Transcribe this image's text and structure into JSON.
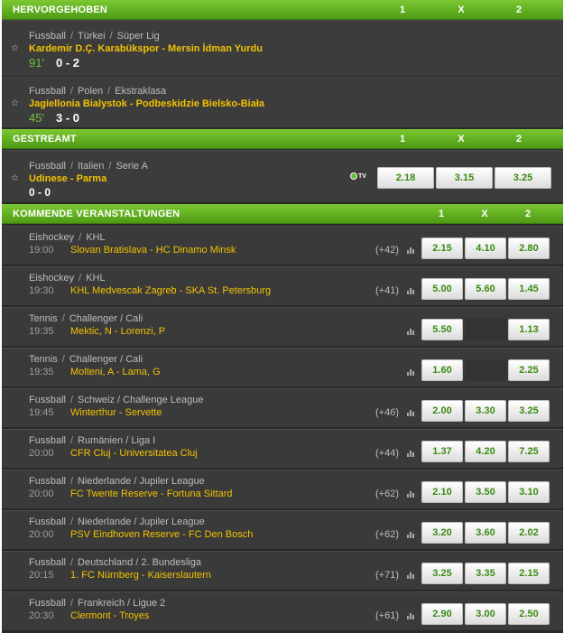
{
  "sections": {
    "featured": {
      "title": "HERVORGEHOBEN",
      "cols": [
        "1",
        "X",
        "2"
      ]
    },
    "streamed": {
      "title": "GESTREAMT",
      "cols": [
        "1",
        "X",
        "2"
      ]
    },
    "upcoming": {
      "title": "KOMMENDE VERANSTALTUNGEN",
      "cols": [
        "1",
        "X",
        "2"
      ]
    }
  },
  "featured": [
    {
      "sport": "Fussball",
      "country": "Türkei",
      "league": "Süper Lig",
      "match": "Kardemir D.Ç. Karabükspor - Mersin İdman Yurdu",
      "minute": "91'",
      "score": "0 - 2"
    },
    {
      "sport": "Fussball",
      "country": "Polen",
      "league": "Ekstraklasa",
      "match": "Jagiellonia Bialystok - Podbeskidzie Bielsko-Biała",
      "minute": "45'",
      "score": "3 - 0"
    }
  ],
  "streamed": [
    {
      "sport": "Fussball",
      "country": "Italien",
      "league": "Serie A",
      "match": "Udinese - Parma",
      "score": "0 - 0",
      "tv": "TV",
      "odds": [
        "2.18",
        "3.15",
        "3.25"
      ]
    }
  ],
  "upcoming": [
    {
      "sport": "Eishockey",
      "league": "KHL",
      "time": "19:00",
      "match": "Slovan Bratislava  -  HC Dinamo Minsk",
      "more": "(+42)",
      "odds": [
        "2.15",
        "4.10",
        "2.80"
      ]
    },
    {
      "sport": "Eishockey",
      "league": "KHL",
      "time": "19:30",
      "match": "KHL Medvescak Zagreb  -  SKA St. Petersburg",
      "more": "(+41)",
      "odds": [
        "5.00",
        "5.60",
        "1.45"
      ]
    },
    {
      "sport": "Tennis",
      "league": "Challenger / Cali",
      "time": "19:35",
      "match": "Mektic, N  -  Lorenzi, P",
      "more": "",
      "odds": [
        "5.50",
        "",
        "1.13"
      ]
    },
    {
      "sport": "Tennis",
      "league": "Challenger / Cali",
      "time": "19:35",
      "match": "Molteni, A  -  Lama, G",
      "more": "",
      "odds": [
        "1.60",
        "",
        "2.25"
      ]
    },
    {
      "sport": "Fussball",
      "league": "Schweiz / Challenge League",
      "time": "19:45",
      "match": "Winterthur  -  Servette",
      "more": "(+46)",
      "odds": [
        "2.00",
        "3.30",
        "3.25"
      ]
    },
    {
      "sport": "Fussball",
      "league": "Rumänien / Liga I",
      "time": "20:00",
      "match": "CFR Cluj  -  Universitatea Cluj",
      "more": "(+44)",
      "odds": [
        "1.37",
        "4.20",
        "7.25"
      ]
    },
    {
      "sport": "Fussball",
      "league": "Niederlande / Jupiler League",
      "time": "20:00",
      "match": "FC Twente Reserve  -  Fortuna Sittard",
      "more": "(+62)",
      "odds": [
        "2.10",
        "3.50",
        "3.10"
      ]
    },
    {
      "sport": "Fussball",
      "league": "Niederlande / Jupiler League",
      "time": "20:00",
      "match": "PSV Eindhoven Reserve  -  FC Den Bosch",
      "more": "(+62)",
      "odds": [
        "3.20",
        "3.60",
        "2.02"
      ]
    },
    {
      "sport": "Fussball",
      "league": "Deutschland / 2. Bundesliga",
      "time": "20:15",
      "match": "1. FC Nürnberg  -  Kaiserslautern",
      "more": "(+71)",
      "odds": [
        "3.25",
        "3.35",
        "2.15"
      ]
    },
    {
      "sport": "Fussball",
      "league": "Frankreich / Ligue 2",
      "time": "20:30",
      "match": "Clermont  -  Troyes",
      "more": "(+61)",
      "odds": [
        "2.90",
        "3.00",
        "2.50"
      ]
    }
  ],
  "icons": {
    "favorite": "star-icon",
    "stats": "bar-chart-icon",
    "stream": "tv-icon"
  },
  "colors": {
    "accent": "#5fae1e",
    "team": "#f2c200",
    "odds": "#3b8a12",
    "panel": "#3a3a3a"
  }
}
